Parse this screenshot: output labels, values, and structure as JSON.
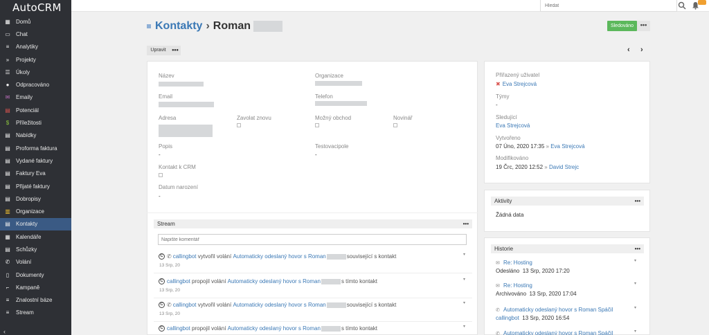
{
  "app": {
    "logo": "AutoCRM"
  },
  "sidebar": {
    "items": [
      {
        "label": "Domů",
        "icon": "grid-icon"
      },
      {
        "label": "Chat",
        "icon": "monitor-icon"
      },
      {
        "label": "Analytiky",
        "icon": "database-icon"
      },
      {
        "label": "Projekty",
        "icon": "double-chevron-icon"
      },
      {
        "label": "Úkoly",
        "icon": "list-icon"
      },
      {
        "label": "Odpracováno",
        "icon": "clock-icon"
      },
      {
        "label": "Emaily",
        "icon": "envelope-icon"
      },
      {
        "label": "Potenciál",
        "icon": "id-card-icon"
      },
      {
        "label": "Příležitosti",
        "icon": "dollar-icon"
      },
      {
        "label": "Nabídky",
        "icon": "document-icon"
      },
      {
        "label": "Proforma faktura",
        "icon": "document-icon"
      },
      {
        "label": "Vydané faktury",
        "icon": "document-icon"
      },
      {
        "label": "Faktury Eva",
        "icon": "document-icon"
      },
      {
        "label": "Přijaté faktury",
        "icon": "document-icon"
      },
      {
        "label": "Dobropisy",
        "icon": "document-icon"
      },
      {
        "label": "Organizace",
        "icon": "building-icon"
      },
      {
        "label": "Kontakty",
        "icon": "contact-icon"
      },
      {
        "label": "Kalendáře",
        "icon": "calendar-icon"
      },
      {
        "label": "Schůzky",
        "icon": "users-icon"
      },
      {
        "label": "Volání",
        "icon": "phone-icon"
      },
      {
        "label": "Dokumenty",
        "icon": "file-icon"
      },
      {
        "label": "Kampaně",
        "icon": "chart-icon"
      },
      {
        "label": "Znalostní báze",
        "icon": "book-icon"
      },
      {
        "label": "Stream",
        "icon": "stream-icon"
      }
    ],
    "active": "Kontakty"
  },
  "topbar": {
    "search_placeholder": "Hledat"
  },
  "header": {
    "breadcrumb_root": "Kontakty",
    "breadcrumb_sep": "›",
    "record_name": "Roman",
    "follow_label": "Sledováno",
    "edit_label": "Upravit",
    "more_label": "•••"
  },
  "detail": {
    "name_label": "Název",
    "organization_label": "Organizace",
    "email_label": "Email",
    "phone_label": "Telefon",
    "address_label": "Adresa",
    "call_again_label": "Zavolat znovu",
    "possible_deal_label": "Možný obchod",
    "newsletter_label": "Novinář",
    "description_label": "Popis",
    "description_value": "-",
    "test_label": "Testovacipole",
    "test_value": "-",
    "contact_crm_label": "Kontakt k CRM",
    "birthday_label": "Datum narození",
    "birthday_value": "-"
  },
  "side": {
    "assigned_label": "Přiřazený uživatel",
    "assigned_value": "Eva Strejcová",
    "teams_label": "Týmy",
    "teams_value": "-",
    "followers_label": "Sledující",
    "followers_value": "Eva Strejcová",
    "created_label": "Vytvořeno",
    "created_value": "07 Úno, 2020 17:35",
    "created_sep": "»",
    "created_by": "Eva Strejcová",
    "modified_label": "Modifikováno",
    "modified_value": "19 Črc, 2020 12:52",
    "modified_sep": "»",
    "modified_by": "David Strejc"
  },
  "activities": {
    "title": "Aktivity",
    "empty": "Žádná data"
  },
  "history": {
    "title": "Historie",
    "items": [
      {
        "link": "Re: Hosting",
        "status": "Odesláno",
        "date": "13 Srp, 2020 17:20"
      },
      {
        "link": "Re: Hosting",
        "status": "Archivováno",
        "date": "13 Srp, 2020 17:04"
      },
      {
        "link": "Automaticky odeslaný hovor s Roman Spáčil",
        "status": "callingbot",
        "date": "13 Srp, 2020 16:54"
      },
      {
        "link": "Automaticky odeslaný hovor s Roman Spáčil"
      }
    ]
  },
  "stream": {
    "title": "Stream",
    "placeholder": "Napište komentář",
    "items": [
      {
        "user": "callingbot",
        "verb": "vytvořil volání",
        "link": "Automaticky odeslaný hovor s Roman",
        "tail": "související s kontakt",
        "date": "13 Srp, 20"
      },
      {
        "user": "callingbot",
        "verb": "propojil volání",
        "link": "Automaticky odeslaný hovor s Roman",
        "tail": "s tímto kontakt",
        "date": "13 Srp, 20"
      },
      {
        "user": "callingbot",
        "verb": "vytvořil volání",
        "link": "Automaticky odeslaný hovor s Roman",
        "tail": "související s kontakt",
        "date": "13 Srp, 20"
      },
      {
        "user": "callingbot",
        "verb": "propojil volání",
        "link": "Automaticky odeslaný hovor s Roman",
        "tail": "s tímto kontakt"
      }
    ]
  },
  "colors": {
    "sidebar_bg": "#2e3035",
    "active_item": "#3a5a84",
    "link": "#3a78b5",
    "follow_btn": "#5cb85c",
    "badge": "#f0a030"
  }
}
